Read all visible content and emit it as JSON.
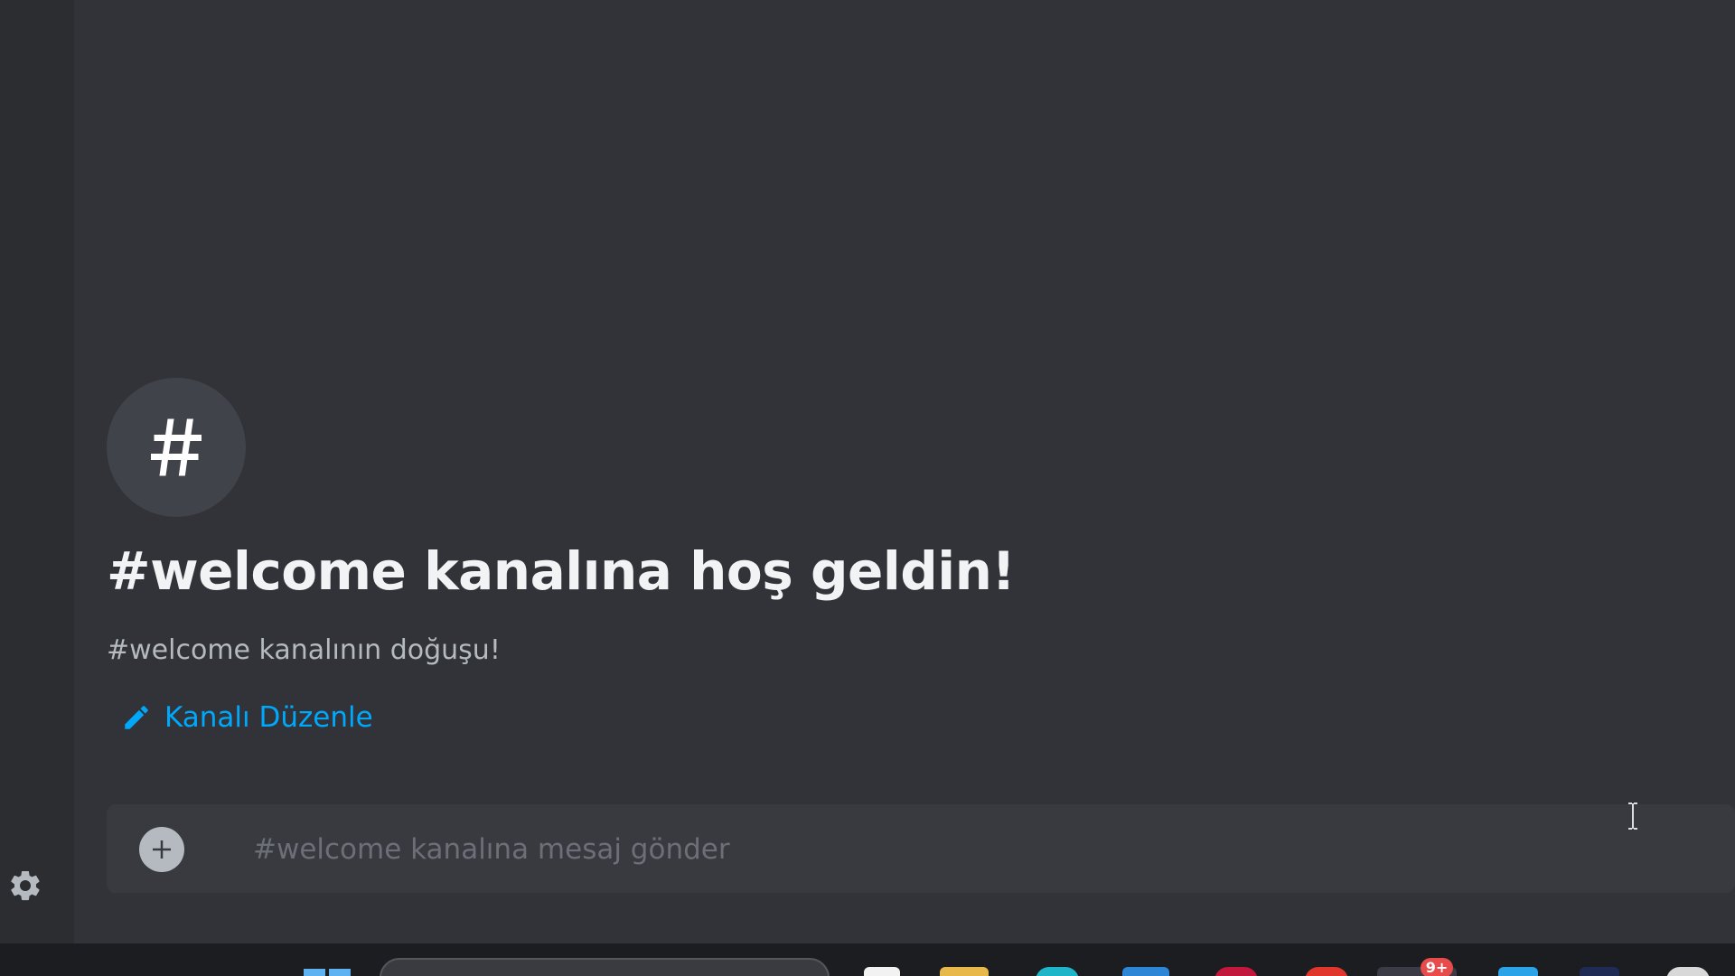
{
  "channel": {
    "name": "welcome",
    "icon": "hash-icon",
    "welcome_title": "#welcome kanalına hoş geldin!",
    "welcome_subtitle": "#welcome kanalının doğuşu!",
    "edit_label": "Kanalı Düzenle"
  },
  "composer": {
    "placeholder": "#welcome kanalına mesaj gönder",
    "value": ""
  },
  "sidebar": {
    "settings_icon": "gear-icon"
  },
  "taskbar": {
    "notification_badge": "9+"
  },
  "colors": {
    "background": "#313338",
    "sidebar": "#2b2d31",
    "link": "#00a8fc",
    "title": "#f2f3f5",
    "muted": "#b5bac1",
    "composer": "#383a40"
  }
}
